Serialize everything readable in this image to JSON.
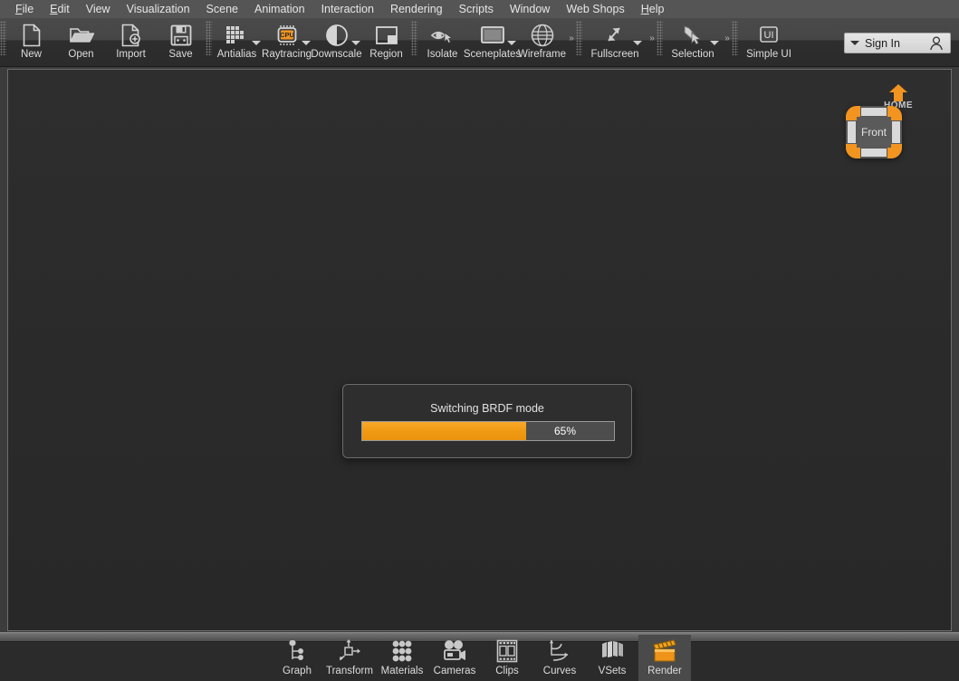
{
  "menu": {
    "items": [
      {
        "label": "File",
        "mnemonic": "F"
      },
      {
        "label": "Edit",
        "mnemonic": "E"
      },
      {
        "label": "View",
        "mnemonic": ""
      },
      {
        "label": "Visualization",
        "mnemonic": ""
      },
      {
        "label": "Scene",
        "mnemonic": ""
      },
      {
        "label": "Animation",
        "mnemonic": ""
      },
      {
        "label": "Interaction",
        "mnemonic": ""
      },
      {
        "label": "Rendering",
        "mnemonic": ""
      },
      {
        "label": "Scripts",
        "mnemonic": ""
      },
      {
        "label": "Window",
        "mnemonic": ""
      },
      {
        "label": "Web Shops",
        "mnemonic": ""
      },
      {
        "label": "Help",
        "mnemonic": "H"
      }
    ]
  },
  "toolbar": {
    "groups": [
      {
        "buttons": [
          {
            "label": "New",
            "icon": "new-document-icon",
            "dropdown": false
          },
          {
            "label": "Open",
            "icon": "open-folder-icon",
            "dropdown": false
          },
          {
            "label": "Import",
            "icon": "import-document-icon",
            "dropdown": false
          },
          {
            "label": "Save",
            "icon": "save-floppy-icon",
            "dropdown": false
          }
        ]
      },
      {
        "buttons": [
          {
            "label": "Antialias",
            "icon": "antialias-grid-icon",
            "dropdown": true
          },
          {
            "label": "Raytracing",
            "icon": "cpu-chip-icon",
            "dropdown": true
          },
          {
            "label": "Downscale",
            "icon": "half-circle-icon",
            "dropdown": true
          },
          {
            "label": "Region",
            "icon": "region-rectangle-icon",
            "dropdown": false
          }
        ]
      },
      {
        "buttons": [
          {
            "label": "Isolate",
            "icon": "eye-cursor-icon",
            "dropdown": false
          },
          {
            "label": "Sceneplates",
            "icon": "sceneplate-rectangle-icon",
            "dropdown": true
          },
          {
            "label": "Wireframe",
            "icon": "wireframe-globe-icon",
            "dropdown": false
          }
        ]
      },
      {
        "buttons": [
          {
            "label": "Fullscreen",
            "icon": "fullscreen-arrows-icon",
            "dropdown": true
          }
        ]
      },
      {
        "buttons": [
          {
            "label": "Selection",
            "icon": "selection-cursor-icon",
            "dropdown": true
          }
        ]
      },
      {
        "buttons": [
          {
            "label": "Simple UI",
            "icon": "simple-ui-icon",
            "dropdown": false
          }
        ]
      }
    ],
    "signin": {
      "label": "Sign In",
      "caret_icon": "chevron-down-icon",
      "user_icon": "user-person-icon"
    }
  },
  "viewport": {
    "background_color": "#2b2b2b",
    "navigation": {
      "home_label": "HOME",
      "home_icon": "home-house-icon",
      "viewcube_face": "Front",
      "accent_color": "#f2941f"
    }
  },
  "dialog": {
    "title": "Switching BRDF mode",
    "progress_percent": 65,
    "progress_label": "65%",
    "fill_color": "#f2941f",
    "track_color": "#4d4d4d"
  },
  "bottombar": {
    "buttons": [
      {
        "label": "Graph",
        "icon": "node-graph-icon",
        "active": false
      },
      {
        "label": "Transform",
        "icon": "transform-gizmo-icon",
        "active": false
      },
      {
        "label": "Materials",
        "icon": "materials-dots-icon",
        "active": false
      },
      {
        "label": "Cameras",
        "icon": "movie-camera-icon",
        "active": false
      },
      {
        "label": "Clips",
        "icon": "film-strip-icon",
        "active": false
      },
      {
        "label": "Curves",
        "icon": "curve-graph-icon",
        "active": false
      },
      {
        "label": "VSets",
        "icon": "variant-sets-icon",
        "active": false
      },
      {
        "label": "Render",
        "icon": "clapperboard-icon",
        "active": true
      }
    ]
  }
}
